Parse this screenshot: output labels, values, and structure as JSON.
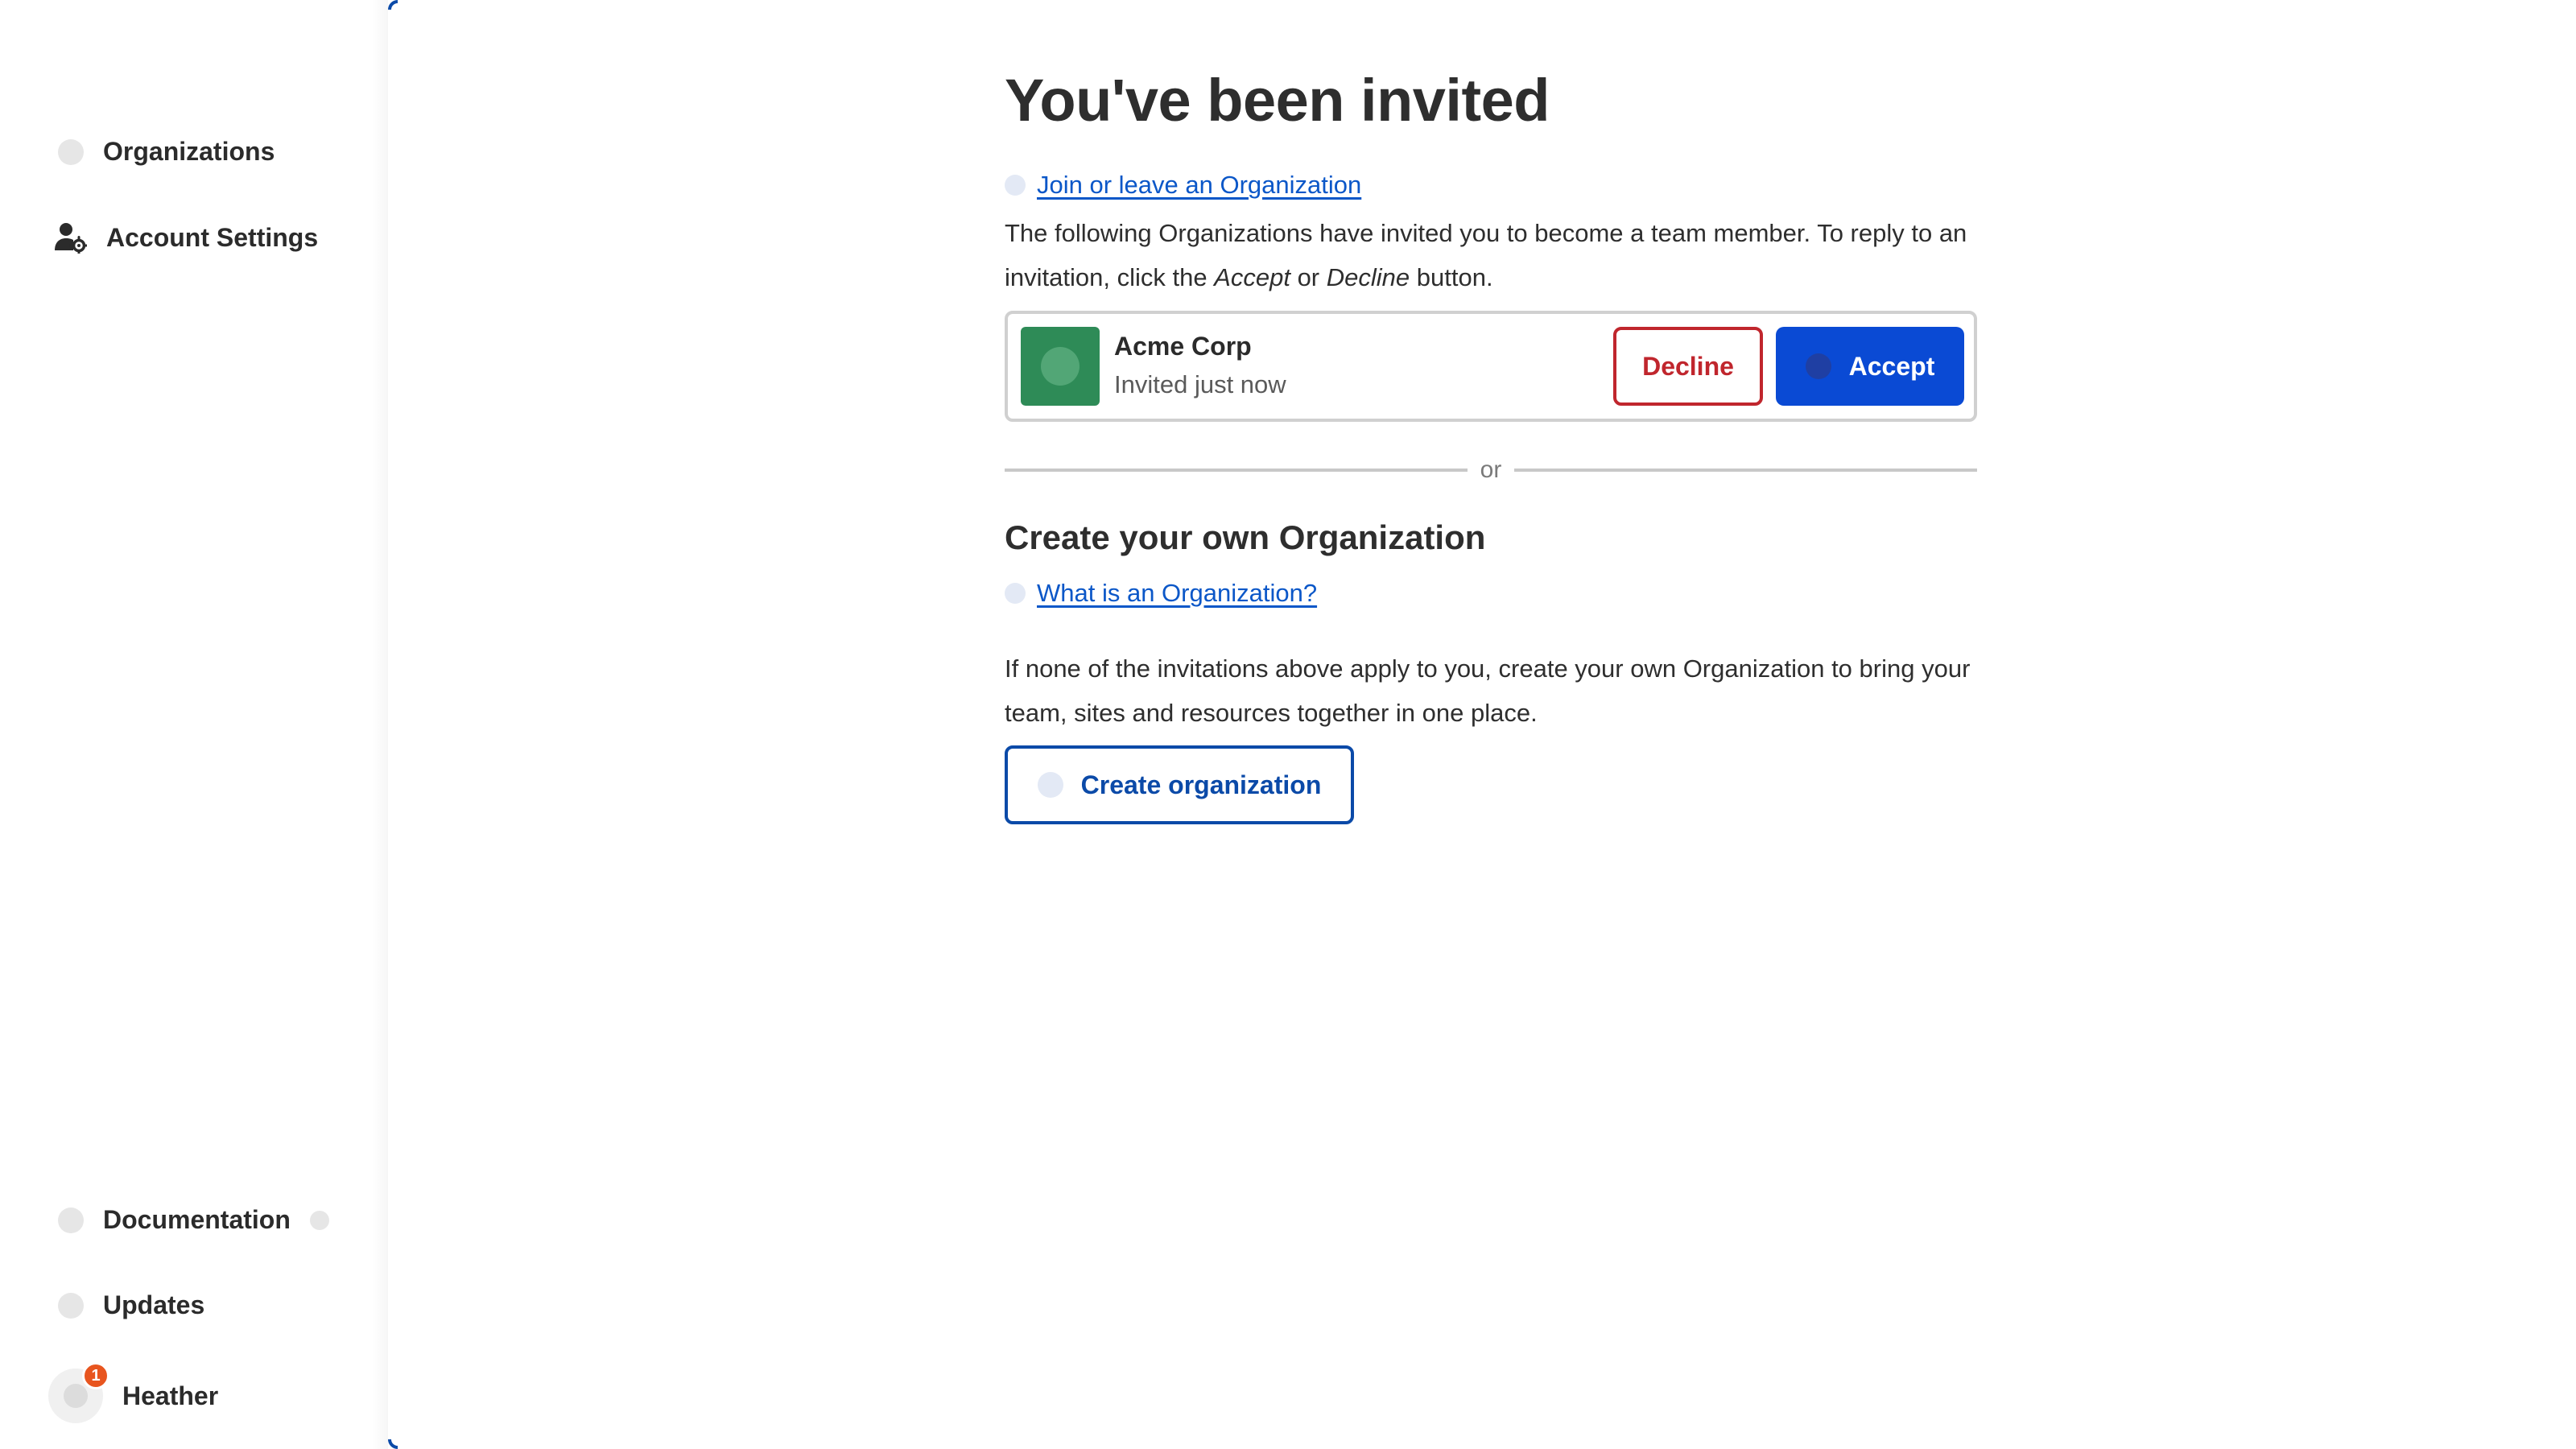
{
  "sidebar": {
    "organizations_label": "Organizations",
    "account_settings_label": "Account Settings",
    "documentation_label": "Documentation",
    "updates_label": "Updates",
    "user_name": "Heather",
    "notification_count": "1"
  },
  "main": {
    "title": "You've been invited",
    "join_link": "Join or leave an Organization",
    "invite_text_1": "The following Organizations have invited you to become a team member. To reply to an invitation, click the ",
    "invite_text_accept": "Accept",
    "invite_text_or": " or ",
    "invite_text_decline": "Decline",
    "invite_text_2": " button.",
    "invitation": {
      "org_name": "Acme Corp",
      "status": "Invited just now",
      "decline_label": "Decline",
      "accept_label": "Accept"
    },
    "divider_text": "or",
    "create_title": "Create your own Organization",
    "what_is_link": "What is an Organization?",
    "create_text": "If none of the invitations above apply to you, create your own Organization to bring your team, sites and resources together in one place.",
    "create_button_label": "Create organization"
  },
  "colors": {
    "primary": "#0a4ad4",
    "danger": "#c0262d",
    "org_logo": "#2e8b57",
    "badge": "#e8551f"
  },
  "icons": {
    "organizations": "organizations-icon",
    "account_settings": "user-gear-icon",
    "documentation": "documentation-icon",
    "external": "external-link-icon",
    "updates": "updates-icon",
    "avatar": "avatar",
    "help": "help-icon"
  }
}
